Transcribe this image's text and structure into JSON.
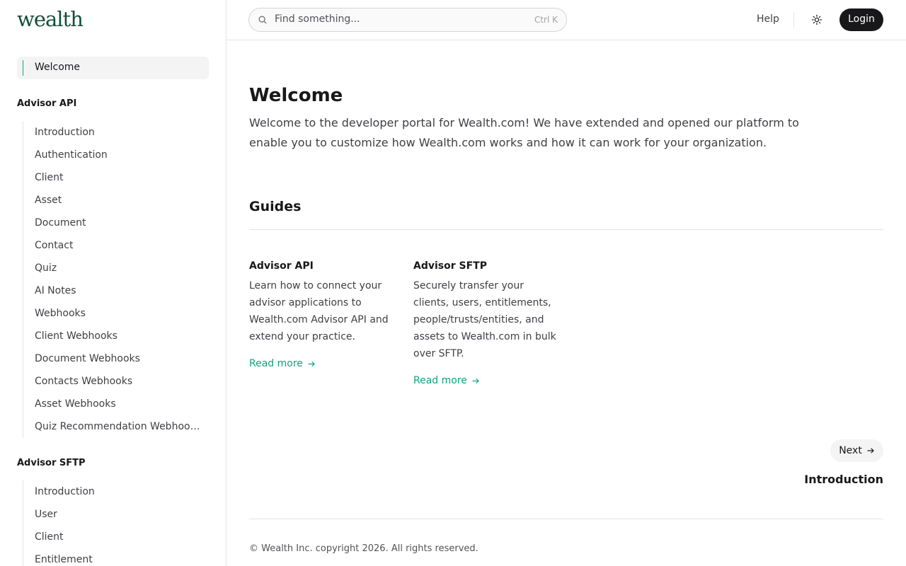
{
  "brand": {
    "logo_text": "wealth"
  },
  "sidebar": {
    "welcome_label": "Welcome",
    "sections": [
      {
        "title": "Advisor API",
        "items": [
          "Introduction",
          "Authentication",
          "Client",
          "Asset",
          "Document",
          "Contact",
          "Quiz",
          "AI Notes",
          "Webhooks",
          "Client Webhooks",
          "Document Webhooks",
          "Contacts Webhooks",
          "Asset Webhooks",
          "Quiz Recommendation Webhoo…"
        ]
      },
      {
        "title": "Advisor SFTP",
        "items": [
          "Introduction",
          "User",
          "Client",
          "Entitlement"
        ]
      }
    ]
  },
  "header": {
    "search_placeholder": "Find something...",
    "search_shortcut": "Ctrl K",
    "help_label": "Help",
    "login_label": "Login",
    "icons": {
      "search": "search-icon",
      "theme": "sun-icon"
    }
  },
  "main": {
    "title": "Welcome",
    "intro": "Welcome to the developer portal for Wealth.com! We have extended and opened our platform to enable you to customize how Wealth.com works and how it can work for your organization.",
    "guides_title": "Guides",
    "guides": [
      {
        "title": "Advisor API",
        "description": "Learn how to connect your advisor applications to Wealth.com Advisor API and extend your practice.",
        "link": "Read more"
      },
      {
        "title": "Advisor SFTP",
        "description": "Securely transfer your clients, users, entitlements, people/trusts/entities, and assets to Wealth.com in bulk over SFTP.",
        "link": "Read more"
      }
    ],
    "next_label": "Next",
    "next_page_title": "Introduction"
  },
  "footer": {
    "copyright": "© Wealth Inc. copyright 2026. All rights reserved."
  },
  "colors": {
    "accent": "#10a37f",
    "brand": "#134e3a",
    "button_dark": "#18181b"
  }
}
